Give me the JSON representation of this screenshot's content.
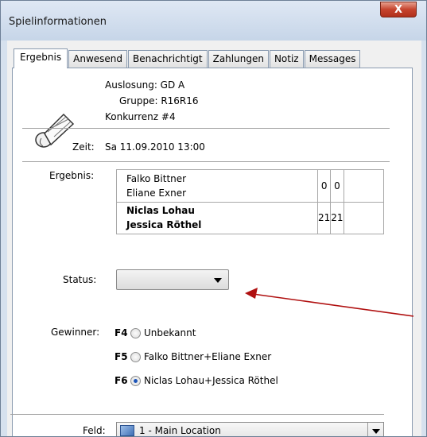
{
  "window": {
    "title": "Spielinformationen",
    "close_label": "X"
  },
  "tabs": [
    {
      "label": "Ergebnis",
      "active": true
    },
    {
      "label": "Anwesend"
    },
    {
      "label": "Benachrichtigt"
    },
    {
      "label": "Zahlungen"
    },
    {
      "label": "Notiz"
    },
    {
      "label": "Messages"
    }
  ],
  "info": {
    "auslosung": "Auslosung: GD A",
    "gruppe": "Gruppe: R16R16",
    "konkurrenz": "Konkurrenz #4",
    "zeit_label": "Zeit:",
    "zeit_value": "Sa 11.09.2010 13:00"
  },
  "result": {
    "label": "Ergebnis:",
    "team1": {
      "player1": "Falko Bittner",
      "player2": "Eliane Exner",
      "set1": "0",
      "set2": "0"
    },
    "team2": {
      "player1": "Niclas Lohau",
      "player2": "Jessica Röthel",
      "set1": "21",
      "set2": "21"
    }
  },
  "status": {
    "label": "Status:",
    "value": ""
  },
  "winner": {
    "label": "Gewinner:",
    "options": [
      {
        "key": "F4",
        "label": "Unbekannt",
        "checked": false
      },
      {
        "key": "F5",
        "label": "Falko Bittner+Eliane Exner",
        "checked": false
      },
      {
        "key": "F6",
        "label": "Niclas Lohau+Jessica Röthel",
        "checked": true
      }
    ]
  },
  "field": {
    "label": "Feld:",
    "value": "1 - Main Location"
  },
  "colors": {
    "arrow": "#b01010",
    "radio_selected": "#1d55b8"
  },
  "icons": [
    "shuttlecock-icon",
    "close-icon",
    "dropdown-arrow-icon",
    "location-icon"
  ]
}
